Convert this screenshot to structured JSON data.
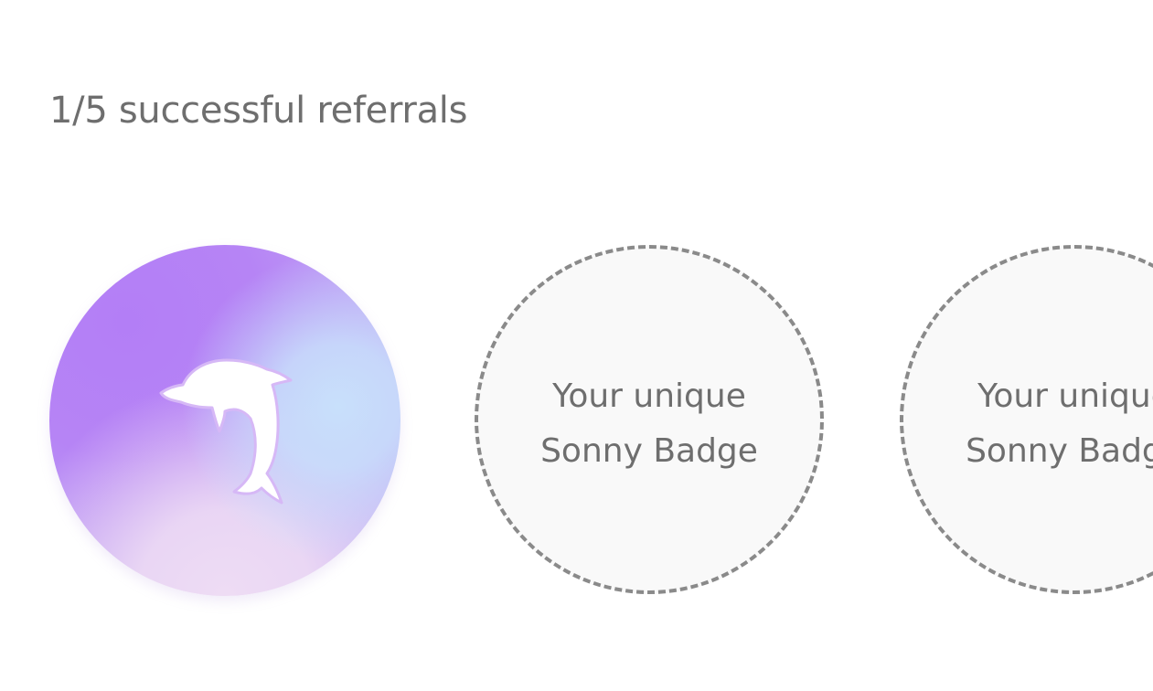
{
  "referrals": {
    "title": "1/5 successful referrals",
    "completed": 1,
    "total": 5
  },
  "badges": [
    {
      "state": "earned",
      "icon": "dolphin-icon"
    },
    {
      "state": "locked",
      "line1": "Your unique",
      "line2": "Sonny Badge"
    },
    {
      "state": "locked",
      "line1": "Your unique",
      "line2": "Sonny Badge"
    }
  ],
  "colors": {
    "text": "#6e6e6e",
    "badge_purple": "#b37ef6",
    "badge_blue": "#c8e0fb",
    "badge_pink": "#eedcf4",
    "dashed_border": "#8a8a8a",
    "empty_fill": "#f9f9f9"
  }
}
